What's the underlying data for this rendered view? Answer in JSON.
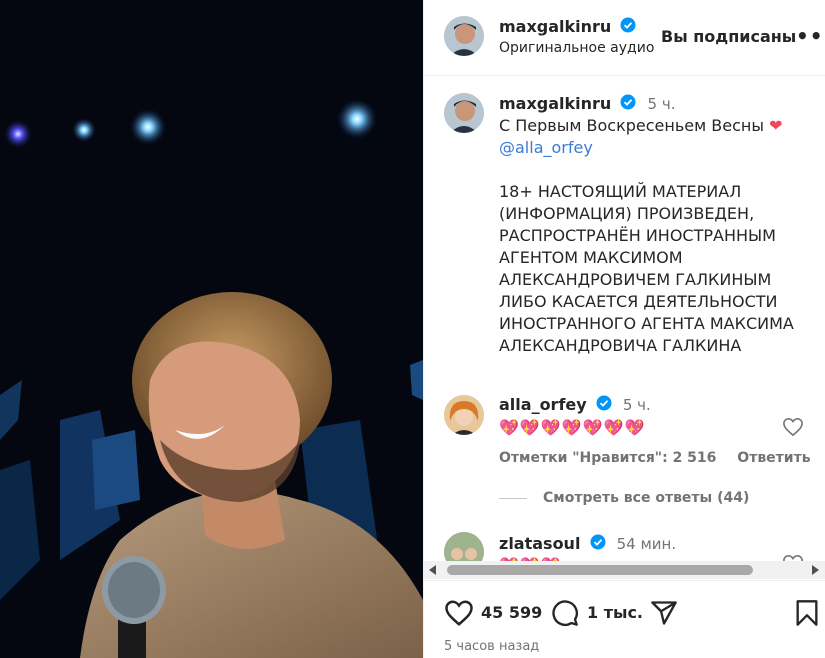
{
  "header": {
    "username": "maxgalkinru",
    "audio_label": "Оригинальное аудио",
    "follow_state": "Вы подписаны",
    "more": "•••"
  },
  "caption": {
    "username": "maxgalkinru",
    "time": "5 ч.",
    "line1": "С Первым Воскресеньем Весны ",
    "emoji": "❤",
    "mention": "@alla_orfey",
    "disclaimer": [
      "18+ НАСТОЯЩИЙ МАТЕРИАЛ",
      "(ИНФОРМАЦИЯ)  ПРОИЗВЕДЕН,",
      "РАСПРОСТРАНЁН ИНОСТРАННЫМ",
      "АГЕНТОМ МАКСИМОМ",
      "АЛЕКСАНДРОВИЧЕМ ГАЛКИНЫМ",
      "ЛИБО КАСАЕТСЯ ДЕЯТЕЛЬНОСТИ",
      "ИНОСТРАННОГО АГЕНТА МАКСИМА",
      "АЛЕКСАНДРОВИЧА ГАЛКИНА"
    ]
  },
  "comments": [
    {
      "username": "alla_orfey",
      "time": "5 ч.",
      "text": "💖💖💖💖💖💖💖",
      "likes_label": "Отметки \"Нравится\": 2 516",
      "reply_label": "Ответить",
      "view_replies": "Смотреть все ответы (44)"
    },
    {
      "username": "zlatasoul",
      "time": "54 мин.",
      "text": "💖💖💖"
    }
  ],
  "actions": {
    "likes": "45 599",
    "comments": "1 тыс.",
    "time_ago": "5 часов назад"
  },
  "colors": {
    "verified": "#0095f6",
    "heart": "#ed4956",
    "muted": "#737373"
  }
}
